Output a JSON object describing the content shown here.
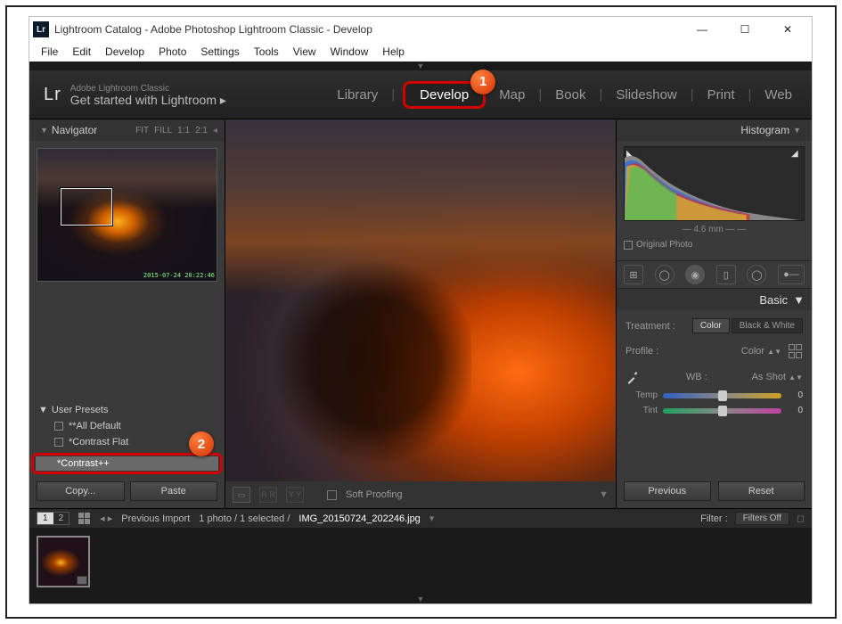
{
  "window": {
    "title": "Lightroom Catalog - Adobe Photoshop Lightroom Classic - Develop",
    "app_icon_text": "Lr"
  },
  "menubar": [
    "File",
    "Edit",
    "Develop",
    "Photo",
    "Settings",
    "Tools",
    "View",
    "Window",
    "Help"
  ],
  "topbar": {
    "logo": "Lr",
    "sub1": "Adobe Lightroom Classic",
    "sub2": "Get started with Lightroom  ▸",
    "modules": [
      "Library",
      "Develop",
      "Map",
      "Book",
      "Slideshow",
      "Print",
      "Web"
    ],
    "active_module": "Develop",
    "badge1": "1"
  },
  "navigator": {
    "title": "Navigator",
    "opts": [
      "FIT",
      "FILL",
      "1:1",
      "2:1"
    ],
    "timestamp": "2015-07-24 20:22:46"
  },
  "presets": {
    "group": "User Presets",
    "items": [
      "**All Default",
      "*Contrast Flat"
    ],
    "selected": "*Contrast++",
    "badge2": "2"
  },
  "left_buttons": {
    "copy": "Copy...",
    "paste": "Paste"
  },
  "histogram": {
    "title": "Histogram",
    "focal": "4.6 mm",
    "original": "Original Photo"
  },
  "basic": {
    "title": "Basic",
    "treatment_label": "Treatment :",
    "color": "Color",
    "bw": "Black & White",
    "profile_label": "Profile :",
    "profile_value": "Color",
    "wb_label": "WB :",
    "wb_value": "As Shot",
    "temp_label": "Temp",
    "temp_value": "0",
    "tint_label": "Tint",
    "tint_value": "0"
  },
  "right_buttons": {
    "previous": "Previous",
    "reset": "Reset"
  },
  "center_toolbar": {
    "soft_proof": "Soft Proofing"
  },
  "footer": {
    "pages": [
      "1",
      "2"
    ],
    "previous_import": "Previous Import",
    "count": "1 photo / 1 selected /",
    "filename": "IMG_20150724_202246.jpg",
    "filter_label": "Filter :",
    "filter_value": "Filters Off"
  },
  "filmstrip": {
    "thumb_index": "1"
  }
}
